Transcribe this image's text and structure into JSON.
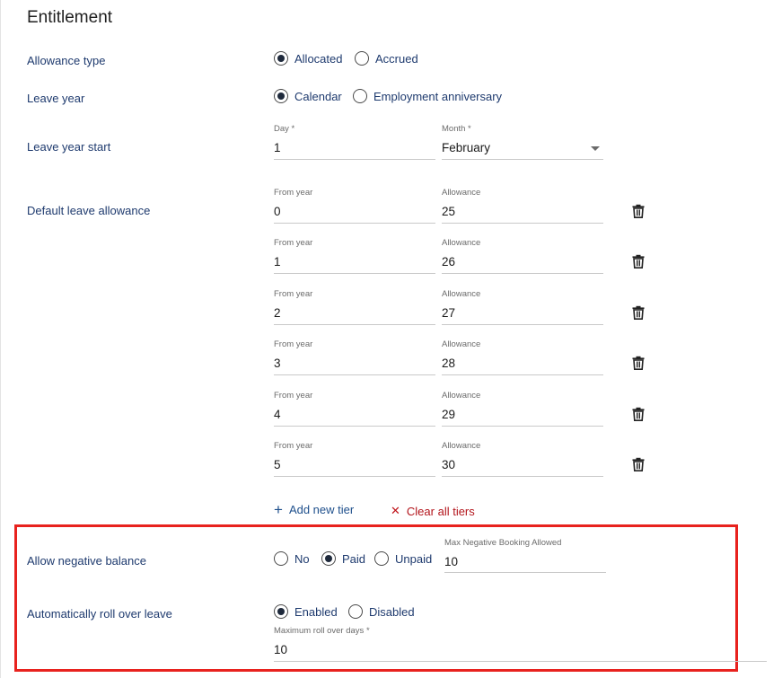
{
  "section_title": "Entitlement",
  "allowance_type": {
    "label": "Allowance type",
    "options": [
      {
        "label": "Allocated",
        "selected": true
      },
      {
        "label": "Accrued",
        "selected": false
      }
    ]
  },
  "leave_year": {
    "label": "Leave year",
    "options": [
      {
        "label": "Calendar",
        "selected": true
      },
      {
        "label": "Employment anniversary",
        "selected": false
      }
    ]
  },
  "leave_year_start": {
    "label": "Leave year start",
    "day_caption": "Day *",
    "day_value": "1",
    "month_caption": "Month *",
    "month_value": "February"
  },
  "default_leave_allowance": {
    "label": "Default leave allowance",
    "from_caption": "From year",
    "allowance_caption": "Allowance",
    "tiers": [
      {
        "from_year": "0",
        "allowance": "25"
      },
      {
        "from_year": "1",
        "allowance": "26"
      },
      {
        "from_year": "2",
        "allowance": "27"
      },
      {
        "from_year": "3",
        "allowance": "28"
      },
      {
        "from_year": "4",
        "allowance": "29"
      },
      {
        "from_year": "5",
        "allowance": "30"
      }
    ],
    "add_tier_label": "Add new tier",
    "clear_tiers_label": "Clear all tiers"
  },
  "negative_balance": {
    "label": "Allow negative balance",
    "options": [
      {
        "label": "No",
        "selected": false
      },
      {
        "label": "Paid",
        "selected": true
      },
      {
        "label": "Unpaid",
        "selected": false
      }
    ],
    "max_caption": "Max Negative Booking Allowed",
    "max_value": "10"
  },
  "roll_over": {
    "label": "Automatically roll over leave",
    "options": [
      {
        "label": "Enabled",
        "selected": true
      },
      {
        "label": "Disabled",
        "selected": false
      }
    ],
    "max_days_caption": "Maximum roll over days *",
    "max_days_value": "10"
  },
  "colors": {
    "label_text": "#1e3a6e",
    "link_blue": "#1e4f8c",
    "clear_red": "#b3141b",
    "highlight_border": "#e8221e"
  }
}
